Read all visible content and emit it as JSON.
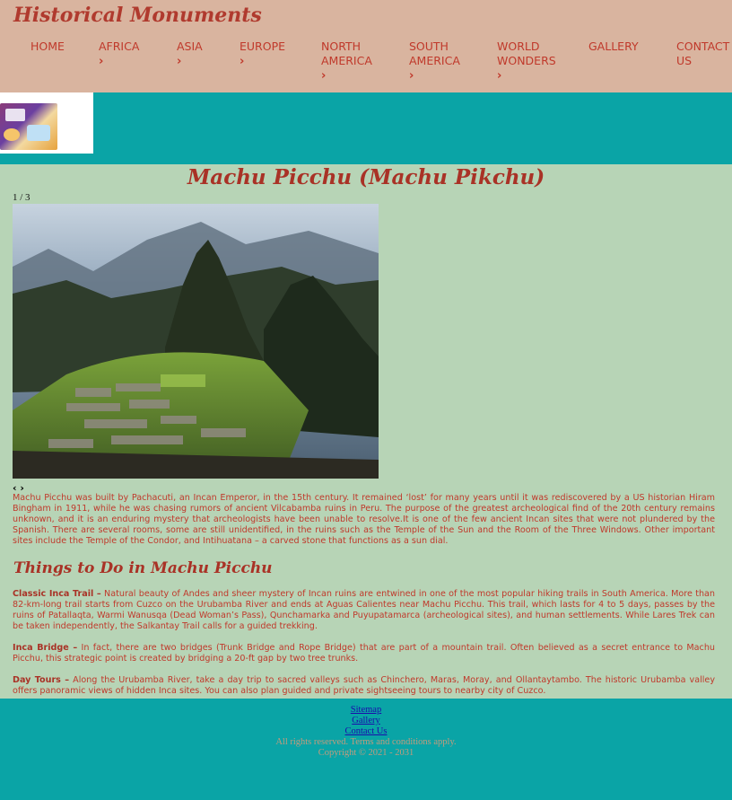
{
  "header": {
    "site_title": "Historical Monuments",
    "nav": [
      {
        "label": "HOME",
        "has_chevron": false
      },
      {
        "label": "AFRICA",
        "has_chevron": true
      },
      {
        "label": "ASIA",
        "has_chevron": true
      },
      {
        "label": "EUROPE",
        "has_chevron": true
      },
      {
        "label": "NORTH AMERICA",
        "has_chevron": true
      },
      {
        "label": "SOUTH AMERICA",
        "has_chevron": true
      },
      {
        "label": "WORLD WONDERS",
        "has_chevron": true
      },
      {
        "label": "GALLERY",
        "has_chevron": false
      },
      {
        "label": "CONTACT US",
        "has_chevron": false
      }
    ],
    "chevron_glyph": "›"
  },
  "main": {
    "page_title": "Machu Picchu (Machu Pikchu)",
    "slideshow": {
      "counter": "1 / 3",
      "prev_glyph": "‹",
      "next_glyph": "›"
    },
    "intro": "Machu Picchu was built by Pachacuti, an Incan Emperor, in the 15th century. It remained ‘lost’ for many years until it was rediscovered by a US historian Hiram Bingham in 1911, while he was chasing rumors of ancient Vilcabamba ruins in Peru. The purpose of the greatest archeological find of the 20th century remains unknown, and it is an enduring mystery that archeologists have been unable to resolve.It is one of the few ancient Incan sites that were not plundered by the Spanish. There are several rooms, some are still unidentified, in the ruins such as the Temple of the Sun and the Room of the Three Windows. Other important sites include the Temple of the Condor, and Intihuatana – a carved stone that functions as a sun dial.",
    "section_title": "Things to Do in Machu Picchu",
    "items": [
      {
        "title": "Classic Inca Trail –",
        "text": " Natural beauty of Andes and sheer mystery of Incan ruins are entwined in one of the most popular hiking trails in South America. More than 82-km-long trail starts from Cuzco on the Urubamba River and ends at Aguas Calientes near Machu Picchu. This trail, which lasts for 4 to 5 days, passes by the ruins of Patallaqta, Warmi Wanusqa (Dead Woman’s Pass), Qunchamarka and Puyupatamarca (archeological sites), and human settlements. While Lares Trek can be taken independently, the Salkantay Trail calls for a guided trekking."
      },
      {
        "title": "Inca Bridge –",
        "text": " In fact, there are two bridges (Trunk Bridge and Rope Bridge) that are part of a mountain trail. Often believed as a secret entrance to Machu Picchu, this strategic point is created by bridging a 20-ft gap by two tree trunks."
      },
      {
        "title": "Day Tours –",
        "text": " Along the Urubamba River, take a day trip to sacred valleys such as Chinchero, Maras, Moray, and Ollantaytambo. The historic Urubamba valley offers panoramic views of hidden Inca sites. You can also plan guided and private sightseeing tours to nearby city of Cuzco."
      }
    ]
  },
  "footer": {
    "links": [
      "Sitemap",
      "Gallery",
      "Contact Us"
    ],
    "rights": "All rights reserved. Terms and conditions apply.",
    "copyright": "Copyright © 2021 - 2031"
  },
  "colors": {
    "header_bg": "#d9b49f",
    "band_bg": "#0aa4a6",
    "page_bg": "#b7d4b6",
    "accent": "#c0392b"
  }
}
